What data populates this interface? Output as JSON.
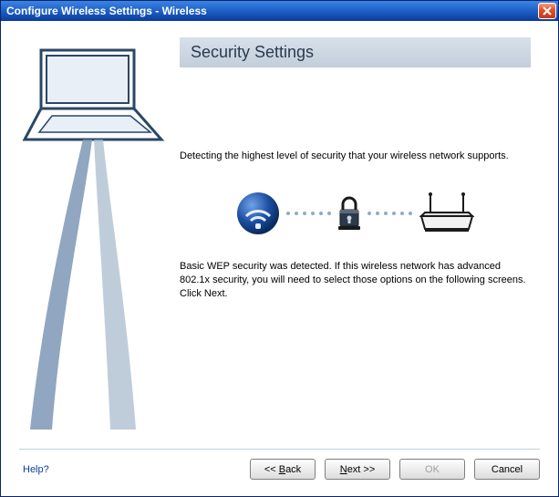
{
  "titlebar": "Configure Wireless Settings - Wireless",
  "header": "Security Settings",
  "detecting_text": "Detecting the highest level of security that your wireless network supports.",
  "result_text": "Basic WEP security was detected. If this wireless network has advanced 802.1x security, you will need to select those options on the following screens. Click Next.",
  "help_label": "Help?",
  "buttons": {
    "back_prefix": "<< ",
    "back_accel": "B",
    "back_rest": "ack",
    "next_accel": "N",
    "next_rest": "ext >>",
    "ok": "OK",
    "cancel": "Cancel"
  }
}
